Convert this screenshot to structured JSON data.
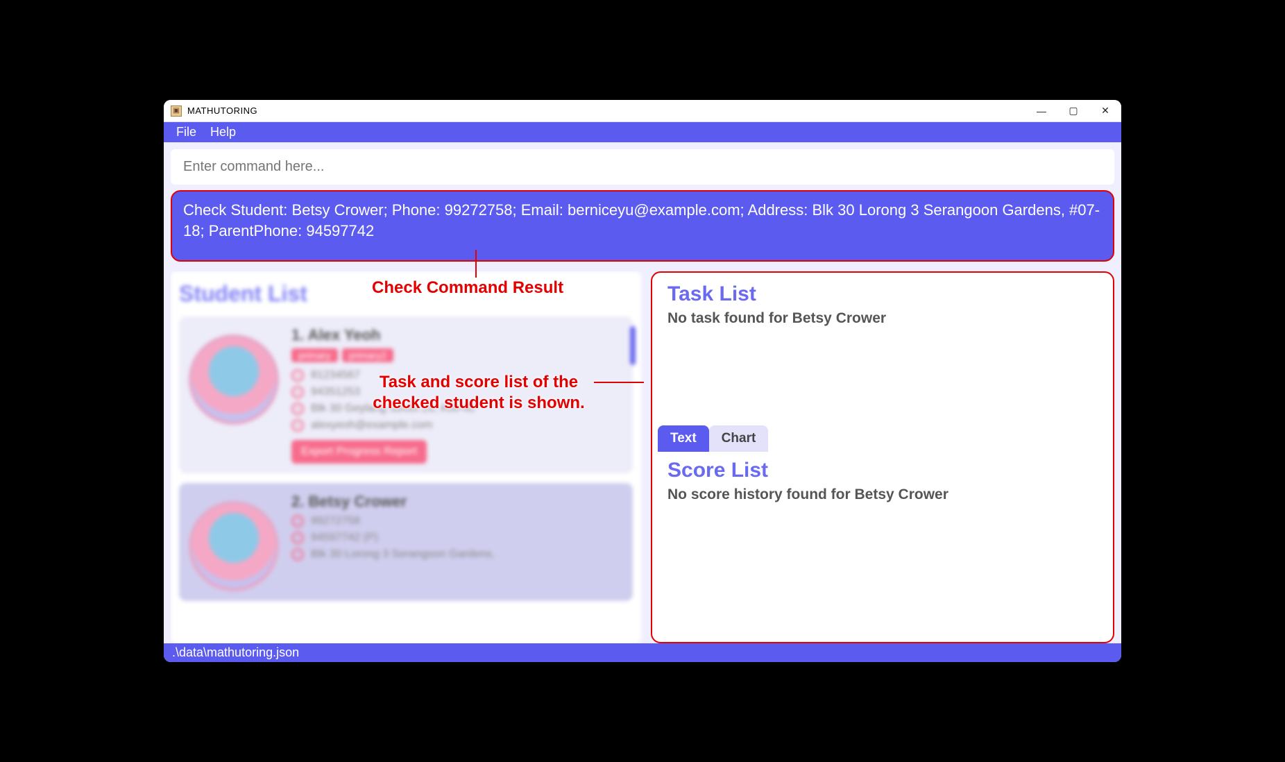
{
  "window": {
    "title": "MATHUTORING"
  },
  "menu": {
    "file": "File",
    "help": "Help"
  },
  "command": {
    "placeholder": "Enter command here..."
  },
  "result": {
    "text": "Check Student: Betsy Crower; Phone: 99272758; Email: berniceyu@example.com; Address: Blk 30 Lorong 3 Serangoon Gardens, #07-18; ParentPhone: 94597742"
  },
  "studentList": {
    "title": "Student List",
    "students": [
      {
        "index": "1.",
        "name": "Alex Yeoh",
        "tags": [
          "primary",
          "primary2"
        ],
        "phone1": "81234567",
        "phone2": "94351253",
        "address": "Blk 30 Geylang Street 29, #06-40",
        "email": "alexyeoh@example.com",
        "exportLabel": "Export Progress Report"
      },
      {
        "index": "2.",
        "name": "Betsy Crower",
        "phone1": "99272758",
        "phone2": "94597742 (P)",
        "address": "Blk 30 Lorong 3 Serangoon Gardens,"
      }
    ]
  },
  "taskList": {
    "title": "Task List",
    "empty": "No task found for Betsy Crower"
  },
  "tabs": {
    "text": "Text",
    "chart": "Chart"
  },
  "scoreList": {
    "title": "Score List",
    "empty": "No score history found for Betsy Crower"
  },
  "status": {
    "path": ".\\data\\mathutoring.json"
  },
  "annotations": {
    "result": "Check Command Result",
    "listNote": "Task and score list of the checked student is shown."
  }
}
